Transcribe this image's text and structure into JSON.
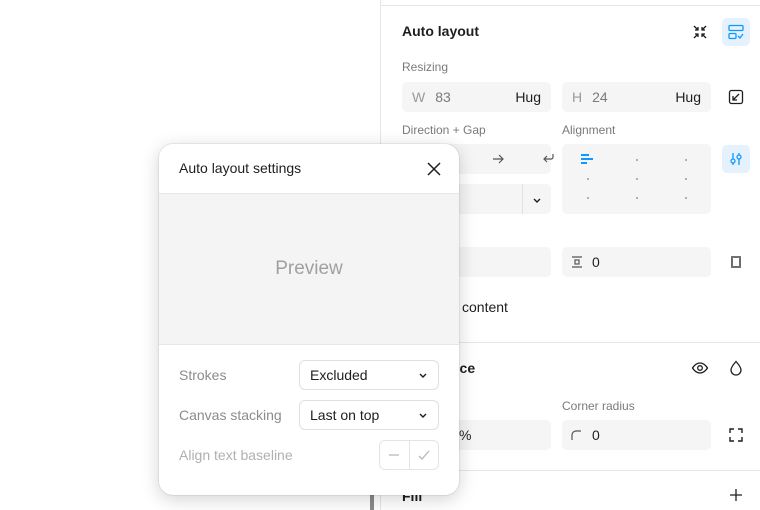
{
  "auto_layout": {
    "title": "Auto layout",
    "resizing_label": "Resizing",
    "width": {
      "prefix": "W",
      "value": "83",
      "mode": "Hug"
    },
    "height": {
      "prefix": "H",
      "value": "24",
      "mode": "Hug"
    },
    "direction_gap_label": "Direction + Gap",
    "alignment_label": "Alignment",
    "spacing_value": "0",
    "clip_content_label": "content"
  },
  "appearance": {
    "title_partial": "nce",
    "corner_radius_label": "Corner radius",
    "opacity_partial": "%",
    "corner_radius_value": "0"
  },
  "fill": {
    "title_partial": "Fill"
  },
  "popup": {
    "title": "Auto layout settings",
    "preview_text": "Preview",
    "strokes_label": "Strokes",
    "strokes_value": "Excluded",
    "canvas_stacking_label": "Canvas stacking",
    "canvas_stacking_value": "Last on top",
    "align_text_baseline_label": "Align text baseline"
  },
  "colors": {
    "accent": "#0d99ff",
    "accent_bg": "#e5f2fd",
    "field_bg": "#f5f5f5"
  }
}
